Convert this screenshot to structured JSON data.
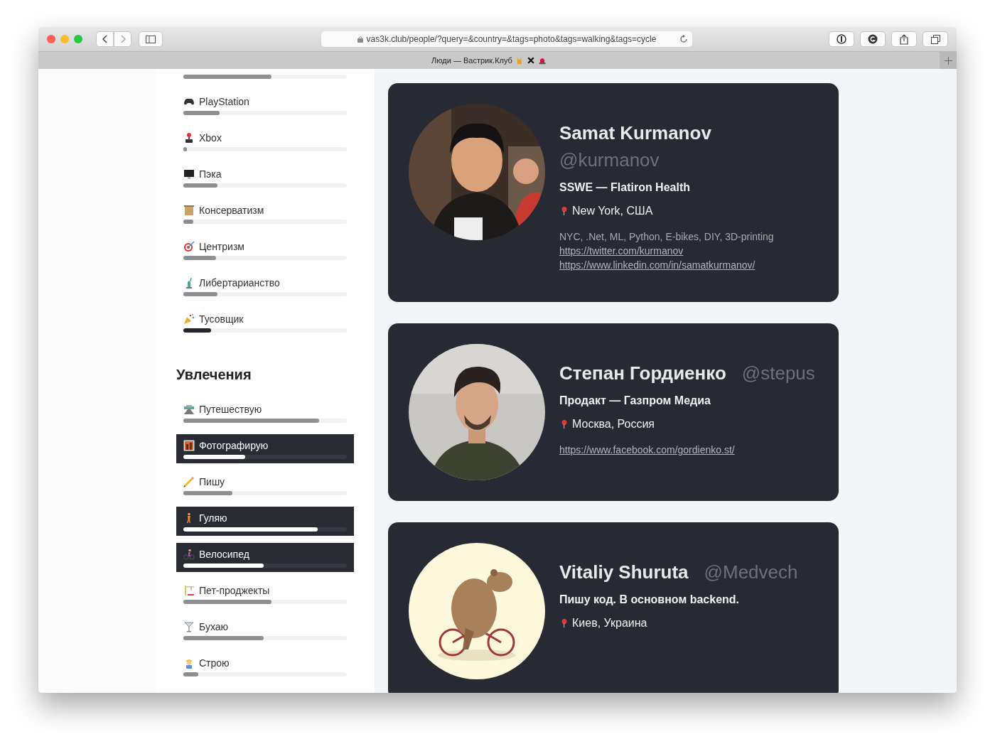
{
  "browser": {
    "url": "vas3k.club/people/?query=&country=&tags=photo&tags=walking&tags=cycle",
    "tab_title": "Люди — Вастрик.Клуб"
  },
  "sidebar": {
    "groups": [
      {
        "items": [
          {
            "level": 0.54,
            "selected": false,
            "highlighted": false
          },
          {
            "label": "PlayStation",
            "level": 0.22,
            "selected": false,
            "highlighted": false
          },
          {
            "label": "Xbox",
            "level": 0.02,
            "selected": false,
            "highlighted": false
          },
          {
            "label": "Пэка",
            "level": 0.21,
            "selected": false,
            "highlighted": false
          },
          {
            "label": "Консерватизм",
            "level": 0.06,
            "selected": false,
            "highlighted": false
          },
          {
            "label": "Центризм",
            "level": 0.2,
            "selected": false,
            "highlighted": false
          },
          {
            "label": "Либертарианство",
            "level": 0.21,
            "selected": false,
            "highlighted": false
          },
          {
            "label": "Тусовщик",
            "level": 0.17,
            "selected": false,
            "highlighted": true
          }
        ]
      },
      {
        "heading": "Увлечения",
        "items": [
          {
            "label": "Путешествую",
            "level": 0.83,
            "selected": false,
            "highlighted": false
          },
          {
            "label": "Фотографирую",
            "level": 0.38,
            "selected": true,
            "highlighted": false
          },
          {
            "label": "Пишу",
            "level": 0.3,
            "selected": false,
            "highlighted": false
          },
          {
            "label": "Гуляю",
            "level": 0.82,
            "selected": true,
            "highlighted": false
          },
          {
            "label": "Велосипед",
            "level": 0.49,
            "selected": true,
            "highlighted": false
          },
          {
            "label": "Пет-проджекты",
            "level": 0.54,
            "selected": false,
            "highlighted": false
          },
          {
            "label": "Бухаю",
            "level": 0.49,
            "selected": false,
            "highlighted": false
          },
          {
            "label": "Строю",
            "level": 0.09,
            "selected": false,
            "highlighted": false
          }
        ]
      }
    ]
  },
  "people": [
    {
      "name": "Samat Kurmanov",
      "handle": "@kurmanov",
      "position": "SSWE — Flatiron Health",
      "location": "New York, США",
      "bio": "NYC, .Net, ML, Python, E-bikes, DIY, 3D-printing",
      "links": [
        "https://twitter.com/kurmanov",
        "https://www.linkedin.com/in/samatkurmanov/"
      ]
    },
    {
      "name": "Степан Гордиенко",
      "handle": "@stepus",
      "position": "Продакт — Газпром Медиа",
      "location": "Москва, Россия",
      "links": [
        "https://www.facebook.com/gordienko.st/"
      ]
    },
    {
      "name": "Vitaliy Shuruta",
      "handle": "@Medvech",
      "position": "Пишу код. В основном backend.",
      "location": "Киев, Украина"
    }
  ]
}
